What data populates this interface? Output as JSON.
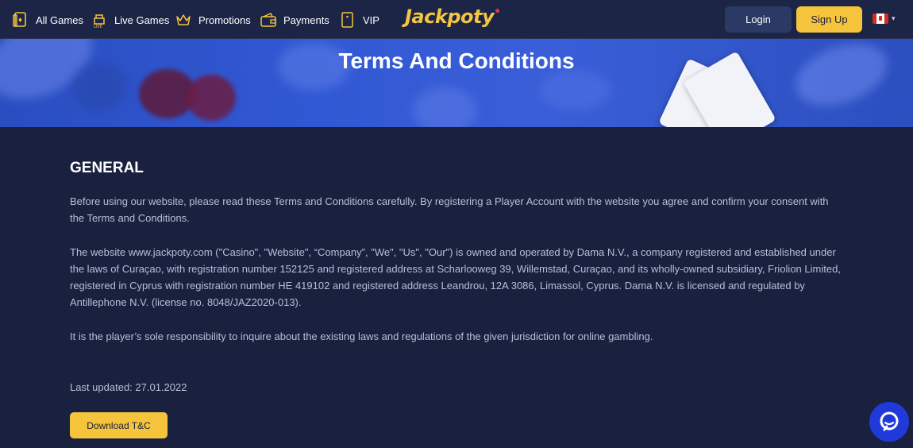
{
  "nav": {
    "items": [
      {
        "label": "All Games",
        "icon": "cards-icon"
      },
      {
        "label": "Live Games",
        "icon": "live-dealer-icon"
      },
      {
        "label": "Promotions",
        "icon": "crown-icon"
      },
      {
        "label": "Payments",
        "icon": "wallet-icon"
      },
      {
        "label": "VIP",
        "icon": "vip-card-icon"
      }
    ],
    "logo": "Jackpoty",
    "login_label": "Login",
    "signup_label": "Sign Up",
    "language_flag": "flag-canada-icon"
  },
  "banner": {
    "title": "Terms And Conditions"
  },
  "content": {
    "heading": "GENERAL",
    "paragraph1": "Before using our website, please read these Terms and Conditions carefully. By registering a Player Account with the website you agree and confirm your consent with the Terms and Conditions.",
    "paragraph2": "The website www.jackpoty.com (\"Casino\", \"Website\", “Company”, \"We\", \"Us\", \"Our\") is owned and operated by Dama N.V., a company registered and established under the laws of Curaçao, with registration number 152125 and registered address at Scharlooweg 39, Willemstad, Curaçao, and its wholly-owned subsidiary, Friolion Limited, registered in Cyprus with registration number HE 419102 and registered address Leandrou, 12A 3086, Limassol, Cyprus. Dama N.V. is licensed and regulated by Antillephone N.V. (license no. 8048/JAZ2020-013).",
    "paragraph3": "It is the player’s sole responsibility to inquire about the existing laws and regulations of the given jurisdiction for online gambling.",
    "last_updated": "Last updated: 27.01.2022",
    "download_label": "Download T&C"
  },
  "colors": {
    "background": "#19213f",
    "accent": "#f5c43c",
    "banner": "#3158d4",
    "chat": "#1f3ad8"
  }
}
